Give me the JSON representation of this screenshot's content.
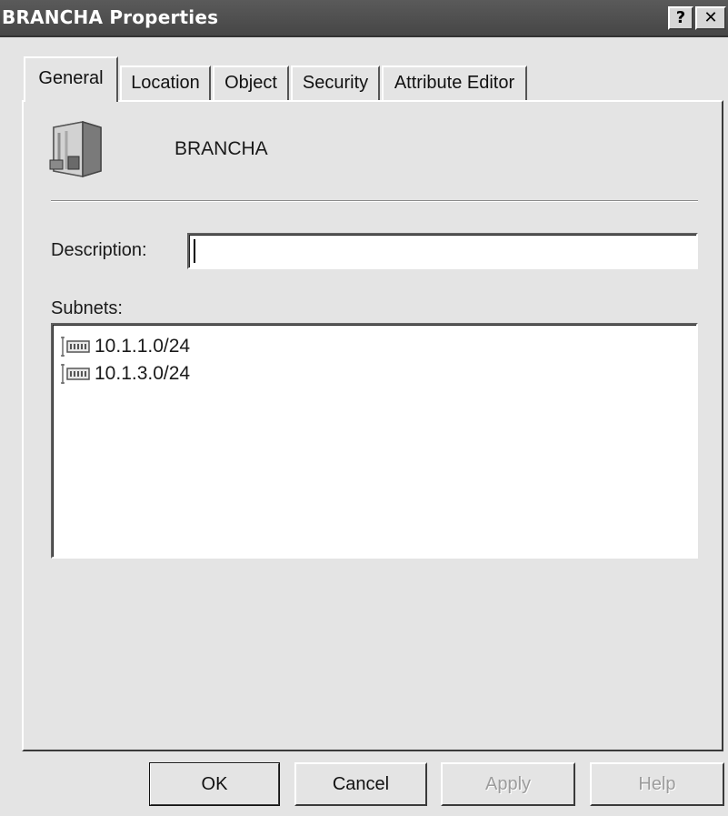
{
  "window": {
    "title": "BRANCHA Properties",
    "help_button": "?",
    "close_button": "✕"
  },
  "tabs": [
    {
      "label": "General",
      "active": true
    },
    {
      "label": "Location",
      "active": false
    },
    {
      "label": "Object",
      "active": false
    },
    {
      "label": "Security",
      "active": false
    },
    {
      "label": "Attribute Editor",
      "active": false
    }
  ],
  "general": {
    "site_icon": "site-server-icon",
    "site_name": "BRANCHA",
    "description_label": "Description:",
    "description_value": "",
    "subnets_label": "Subnets:",
    "subnets": [
      {
        "icon": "subnet-icon",
        "name": "10.1.1.0/24"
      },
      {
        "icon": "subnet-icon",
        "name": "10.1.3.0/24"
      }
    ]
  },
  "buttons": {
    "ok": "OK",
    "cancel": "Cancel",
    "apply": "Apply",
    "help": "Help"
  },
  "colors": {
    "titlebar": "#4f4f4f",
    "dialog_face": "#e4e4e4",
    "field_background": "#ffffff",
    "disabled_text": "#9c9c9c"
  }
}
